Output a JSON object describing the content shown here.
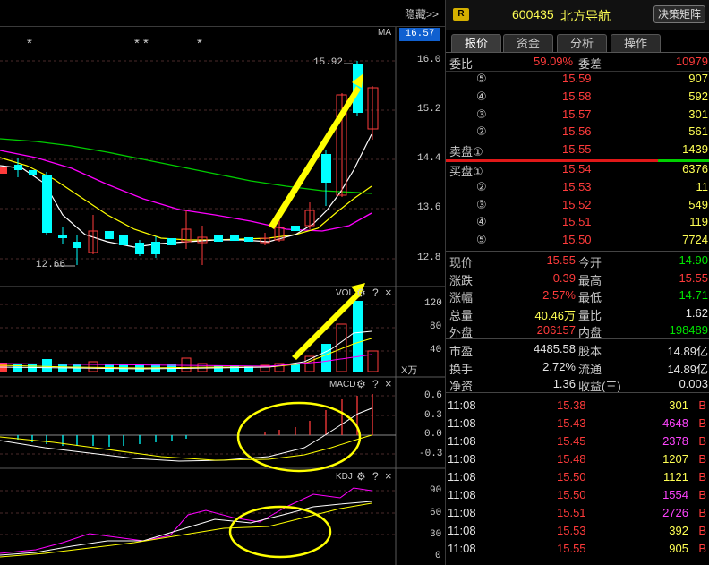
{
  "header": {
    "hide_label": "隐藏>>",
    "r_badge": "R",
    "stock_code": "600435",
    "stock_name": "北方导航",
    "matrix_button": "决策矩阵"
  },
  "tabs": [
    "报价",
    "资金",
    "分析",
    "操作"
  ],
  "chart": {
    "ma_label": "MA",
    "current_price_tag": "16.57",
    "price_axis": [
      "16.0",
      "15.2",
      "14.4",
      "13.6",
      "12.8"
    ],
    "high_label": "15.92",
    "low_label": "12.66",
    "stars": [
      "*",
      "* *",
      "*"
    ],
    "vol_label": "VOL",
    "vol_axis": [
      "120",
      "80",
      "40"
    ],
    "vol_unit": "X万",
    "macd_label": "MACD",
    "macd_axis": [
      "0.6",
      "0.3",
      "0.0",
      "-0.3"
    ],
    "kdj_label": "KDJ",
    "kdj_axis": [
      "90",
      "60",
      "30",
      "0"
    ],
    "question_mark": "?",
    "close_mark": "×"
  },
  "orderbook": {
    "ratio_label": "委比",
    "ratio_value": "59.09%",
    "diff_label": "委差",
    "diff_value": "10979",
    "sell": [
      {
        "level": "⑤",
        "price": "15.59",
        "vol": "907"
      },
      {
        "level": "④",
        "price": "15.58",
        "vol": "592"
      },
      {
        "level": "③",
        "price": "15.57",
        "vol": "301"
      },
      {
        "level": "②",
        "price": "15.56",
        "vol": "561"
      },
      {
        "level": "卖盘①",
        "price": "15.55",
        "vol": "1439"
      }
    ],
    "buy": [
      {
        "level": "买盘①",
        "price": "15.54",
        "vol": "6376"
      },
      {
        "level": "②",
        "price": "15.53",
        "vol": "11"
      },
      {
        "level": "③",
        "price": "15.52",
        "vol": "549"
      },
      {
        "level": "④",
        "price": "15.51",
        "vol": "119"
      },
      {
        "level": "⑤",
        "price": "15.50",
        "vol": "7724"
      }
    ]
  },
  "quote": [
    {
      "l1": "现价",
      "v1": "15.55",
      "c1": "red",
      "l2": "今开",
      "v2": "14.90",
      "c2": "green"
    },
    {
      "l1": "涨跌",
      "v1": "0.39",
      "c1": "red",
      "l2": "最高",
      "v2": "15.55",
      "c2": "red"
    },
    {
      "l1": "涨幅",
      "v1": "2.57%",
      "c1": "red",
      "l2": "最低",
      "v2": "14.71",
      "c2": "green"
    },
    {
      "l1": "总量",
      "v1": "40.46万",
      "c1": "yellow",
      "l2": "量比",
      "v2": "1.62",
      "c2": "white"
    },
    {
      "l1": "外盘",
      "v1": "206157",
      "c1": "red",
      "l2": "内盘",
      "v2": "198489",
      "c2": "green"
    }
  ],
  "fundamentals": [
    {
      "l1": "市盈",
      "v1": "4485.58",
      "l2": "股本",
      "v2": "14.89亿"
    },
    {
      "l1": "换手",
      "v1": "2.72%",
      "l2": "流通",
      "v2": "14.89亿"
    },
    {
      "l1": "净资",
      "v1": "1.36",
      "l2": "收益(三)",
      "v2": "0.003"
    }
  ],
  "ticks": [
    {
      "time": "11:08",
      "price": "15.38",
      "vol": "301",
      "vc": "yellow",
      "side": "B"
    },
    {
      "time": "11:08",
      "price": "15.43",
      "vol": "4648",
      "vc": "magenta",
      "side": "B"
    },
    {
      "time": "11:08",
      "price": "15.45",
      "vol": "2378",
      "vc": "magenta",
      "side": "B"
    },
    {
      "time": "11:08",
      "price": "15.48",
      "vol": "1207",
      "vc": "yellow",
      "side": "B"
    },
    {
      "time": "11:08",
      "price": "15.50",
      "vol": "1121",
      "vc": "yellow",
      "side": "B"
    },
    {
      "time": "11:08",
      "price": "15.50",
      "vol": "1554",
      "vc": "magenta",
      "side": "B"
    },
    {
      "time": "11:08",
      "price": "15.51",
      "vol": "2726",
      "vc": "magenta",
      "side": "B"
    },
    {
      "time": "11:08",
      "price": "15.53",
      "vol": "392",
      "vc": "yellow",
      "side": "B"
    },
    {
      "time": "11:08",
      "price": "15.55",
      "vol": "905",
      "vc": "yellow",
      "side": "B"
    }
  ],
  "colors": {
    "up": "#ff3b3b",
    "down": "#00ffff",
    "ma5": "#ffffff",
    "ma10": "#ffff00",
    "ma20": "#ff00ff",
    "ma60": "#00cc00"
  }
}
